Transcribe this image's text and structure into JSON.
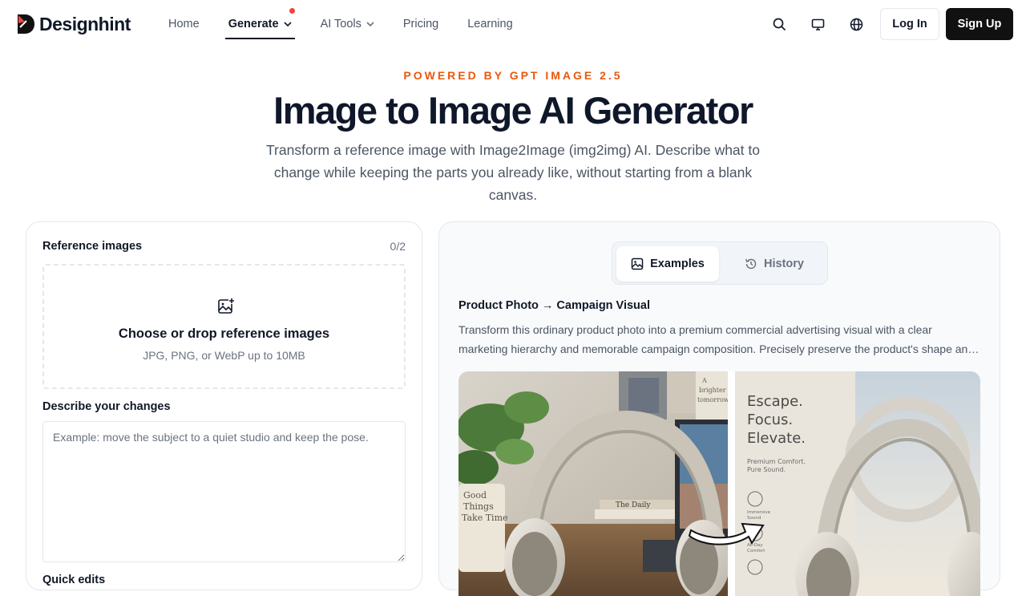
{
  "header": {
    "logo_text": "Designhint",
    "nav": [
      {
        "label": "Home"
      },
      {
        "label": "Generate"
      },
      {
        "label": "AI Tools"
      },
      {
        "label": "Pricing"
      },
      {
        "label": "Learning"
      }
    ],
    "login_label": "Log In",
    "signup_label": "Sign Up"
  },
  "hero": {
    "eyebrow": "POWERED BY GPT IMAGE 2.5",
    "title": "Image to Image AI Generator",
    "subtitle": "Transform a reference image with Image2Image (img2img) AI. Describe what to change while keeping the parts you already like, without starting from a blank canvas."
  },
  "form": {
    "reference_label": "Reference images",
    "reference_count": "0/2",
    "drop_title": "Choose or drop reference images",
    "drop_sub": "JPG, PNG, or WebP up to 10MB",
    "describe_label": "Describe your changes",
    "describe_placeholder": "Example: move the subject to a quiet studio and keep the pose.",
    "next_label": "Quick edits"
  },
  "examples": {
    "tabs": [
      "Examples",
      "History"
    ],
    "title": "Product Photo → Campaign Visual",
    "desc_line1": "Transform this ordinary product photo into a premium commercial advertising visual with a clear",
    "desc_line2": "marketing hierarchy and memorable campaign composition. Precisely preserve the product's shape and details.",
    "poster": {
      "headline1": "Escape.",
      "headline2": "Focus.",
      "headline3": "Elevate.",
      "sub1": "Premium Comfort.",
      "sub2": "Pure Sound.",
      "feat1a": "Immersive",
      "feat1b": "Sound",
      "feat2a": "All-Day",
      "feat2b": "Comfort"
    },
    "mug_line1": "Good",
    "mug_line2": "Things",
    "mug_line3": "Take Time",
    "book_label": "The Daily",
    "note_line1": "A",
    "note_line2": "brighter",
    "note_line3": "tomorrow"
  },
  "colors": {
    "accent": "#ea580c",
    "brand_dark": "#111111",
    "notification": "#ef4444"
  }
}
